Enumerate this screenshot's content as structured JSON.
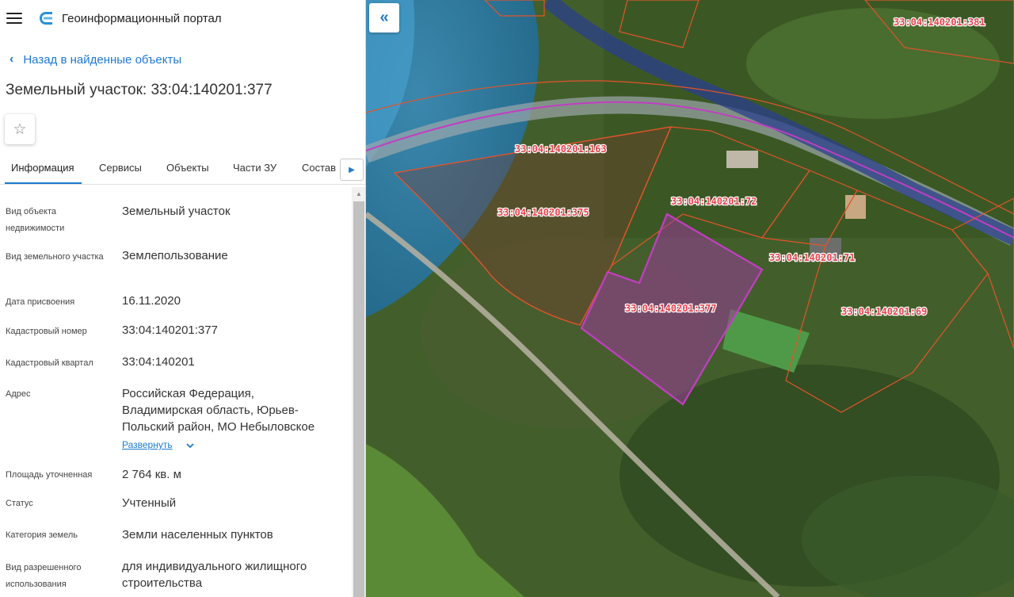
{
  "header": {
    "title": "Геоинформационный портал",
    "menu_icon": "hamburger-icon",
    "logo_icon": "portal-logo-icon"
  },
  "back_link": {
    "label": "Назад в найденные объекты"
  },
  "object": {
    "title": "Земельный участок: 33:04:140201:377"
  },
  "tabs": [
    {
      "label": "Информация",
      "active": true
    },
    {
      "label": "Сервисы"
    },
    {
      "label": "Объекты"
    },
    {
      "label": "Части ЗУ"
    },
    {
      "label": "Состав"
    }
  ],
  "properties": [
    {
      "label": "Вид объекта недвижимости",
      "value": "Земельный участок"
    },
    {
      "label": "Вид земельного участка",
      "value": "Землепользование"
    },
    {
      "label": "Дата присвоения",
      "value": "16.11.2020"
    },
    {
      "label": "Кадастровый номер",
      "value": "33:04:140201:377"
    },
    {
      "label": "Кадастровый квартал",
      "value": "33:04:140201"
    },
    {
      "label": "Адрес",
      "value": "Российская Федерация, Владимирская область, Юрьев-Польский район, МО Небыловское"
    },
    {
      "label": "Площадь уточненная",
      "value": "2 764 кв. м"
    },
    {
      "label": "Статус",
      "value": "Учтенный"
    },
    {
      "label": "Категория земель",
      "value": "Земли населенных пунктов"
    },
    {
      "label": "Вид разрешенного использования",
      "value": "для индивидуального жилищного строительства"
    }
  ],
  "address_expand": {
    "label": "Развернуть"
  },
  "map": {
    "parcel_labels": [
      "33:04:140201:381",
      "33:04:140201:163",
      "33:04:140201:375",
      "33:04:140201:72",
      "33:04:140201:71",
      "33:04:140201:377",
      "33:04:140201:69"
    ],
    "colors": {
      "accent": "#1d7ad1",
      "parcel_border": "#e2542a",
      "selected_parcel": "#c23ec2",
      "label_text": "#e8434c"
    }
  }
}
